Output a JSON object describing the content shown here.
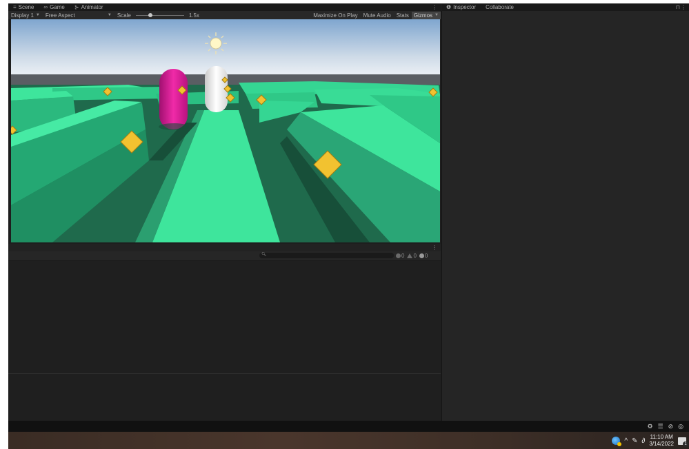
{
  "scene_tabs": [
    {
      "label": "Scene",
      "icon": "hamburger-icon",
      "glyph": "≡"
    },
    {
      "label": "Game",
      "icon": "gamepad-icon",
      "glyph": "∞"
    },
    {
      "label": "Animator",
      "icon": "animator-icon",
      "glyph": "⊱"
    }
  ],
  "right_tabs": [
    {
      "label": "Inspector",
      "icon": "info-icon",
      "glyph": "❶"
    },
    {
      "label": "Collaborate"
    }
  ],
  "game_toolbar": {
    "display": "Display 1",
    "aspect": "Free Aspect",
    "scale_label": "Scale",
    "scale_value": "1.5x",
    "maximize": "Maximize On Play",
    "mute": "Mute Audio",
    "stats": "Stats",
    "gizmos": "Gizmos"
  },
  "console": {
    "error_count": "0",
    "warning_count": "0",
    "info_count": "0"
  },
  "taskbar": {
    "time": "11:10 AM",
    "date": "3/14/2022",
    "notifications": "1"
  },
  "colors": {
    "maze_floor": "#1f6a4c",
    "maze_top": "#3ee59c",
    "capsule_player": "#e6189a",
    "capsule_other": "#f2f2f2",
    "pickup": "#f2c230"
  }
}
